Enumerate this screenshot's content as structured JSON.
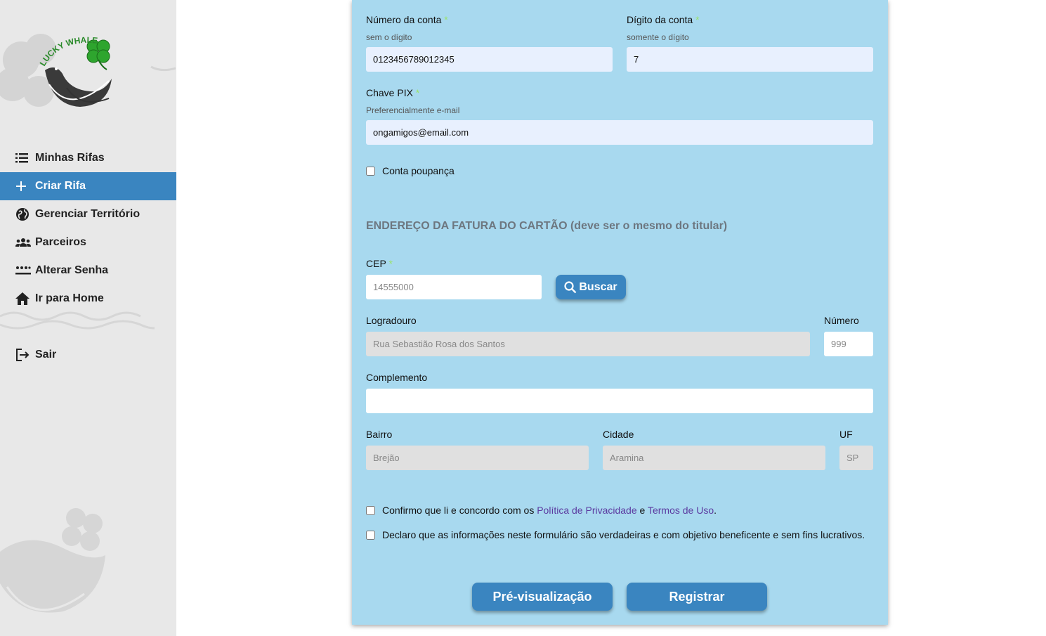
{
  "brand": {
    "logo_text": "LUCKY WHALE"
  },
  "sidebar": {
    "items": [
      {
        "label": "Minhas Rifas",
        "icon": "list-icon"
      },
      {
        "label": "Criar Rifa",
        "icon": "plus-icon",
        "active": true
      },
      {
        "label": "Gerenciar Território",
        "icon": "globe-icon"
      },
      {
        "label": "Parceiros",
        "icon": "group-icon"
      },
      {
        "label": "Alterar Senha",
        "icon": "password-icon"
      },
      {
        "label": "Ir para Home",
        "icon": "home-icon"
      },
      {
        "label": "Sair",
        "icon": "logout-icon"
      }
    ]
  },
  "form": {
    "numero_conta": {
      "label": "Número da conta",
      "required_mark": "*",
      "hint": "sem o dígito",
      "value": "0123456789012345"
    },
    "digito_conta": {
      "label": "Dígito da conta",
      "required_mark": "*",
      "hint": "somente o dígito",
      "value": "7"
    },
    "chave_pix": {
      "label": "Chave PIX",
      "required_mark": "*",
      "hint": "Preferencialmente e-mail",
      "value": "ongamigos@email.com"
    },
    "conta_poupanca": {
      "label": "Conta poupança",
      "checked": false
    },
    "address_section_title": "ENDEREÇO DA FATURA DO CARTÃO (deve ser o mesmo do titular)",
    "cep": {
      "label": "CEP",
      "required_mark": "*",
      "placeholder": "14555000"
    },
    "buscar_label": "Buscar",
    "logradouro": {
      "label": "Logradouro",
      "placeholder": "Rua Sebastião Rosa dos Santos"
    },
    "numero": {
      "label": "Número",
      "placeholder": "999"
    },
    "complemento": {
      "label": "Complemento",
      "value": ""
    },
    "bairro": {
      "label": "Bairro",
      "placeholder": "Brejão"
    },
    "cidade": {
      "label": "Cidade",
      "placeholder": "Aramina"
    },
    "uf": {
      "label": "UF",
      "placeholder": "SP"
    },
    "confirm_terms": {
      "prefix": "Confirmo que li e concordo com os",
      "privacy_link": "Política de Privacidade",
      "conjunction": "e",
      "terms_link": "Termos de Uso",
      "suffix": "."
    },
    "declare": "Declaro que as informações neste formulário são verdadeiras e com objetivo beneficente e sem fins lucrativos.",
    "preview_label": "Pré-visualização",
    "register_label": "Registrar"
  },
  "colors": {
    "accent": "#3a85c0",
    "card_bg": "#a8d9ef",
    "required": "#9ae36a",
    "link": "#5b3aa0"
  }
}
